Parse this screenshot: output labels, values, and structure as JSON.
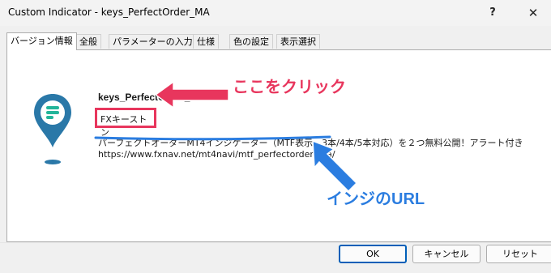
{
  "window": {
    "title": "Custom Indicator - keys_PerfectOrder_MA",
    "help_label": "?",
    "close_label": "✕"
  },
  "tabs": [
    {
      "label": "バージョン情報",
      "active": true
    },
    {
      "label": "全般",
      "active": false
    },
    {
      "label": "パラメーターの入力",
      "active": false
    },
    {
      "label": "仕様",
      "active": false
    },
    {
      "label": "色の設定",
      "active": false
    },
    {
      "label": "表示選択",
      "active": false
    }
  ],
  "about": {
    "indicator_name": "keys_PerfectOrder_MA 2.4",
    "author": "FXキーストン",
    "description": "パーフェクトオーダーMT4インジケーター（MTF表示、3本/4本/5本対応）を２つ無料公開！アラート付き",
    "url": "https://www.fxnav.net/mt4navi/mtf_perfectorder_ma/"
  },
  "buttons": {
    "ok": "OK",
    "cancel": "キャンセル",
    "reset": "リセット"
  },
  "annotations": {
    "click_here": "ここをクリック",
    "indicator_url": "インジのURL",
    "colors": {
      "pink": "#e8365d",
      "blue": "#2b7de0"
    }
  },
  "logo": {
    "icon": "map-pin-logo-icon",
    "color": "#2a78a8"
  }
}
